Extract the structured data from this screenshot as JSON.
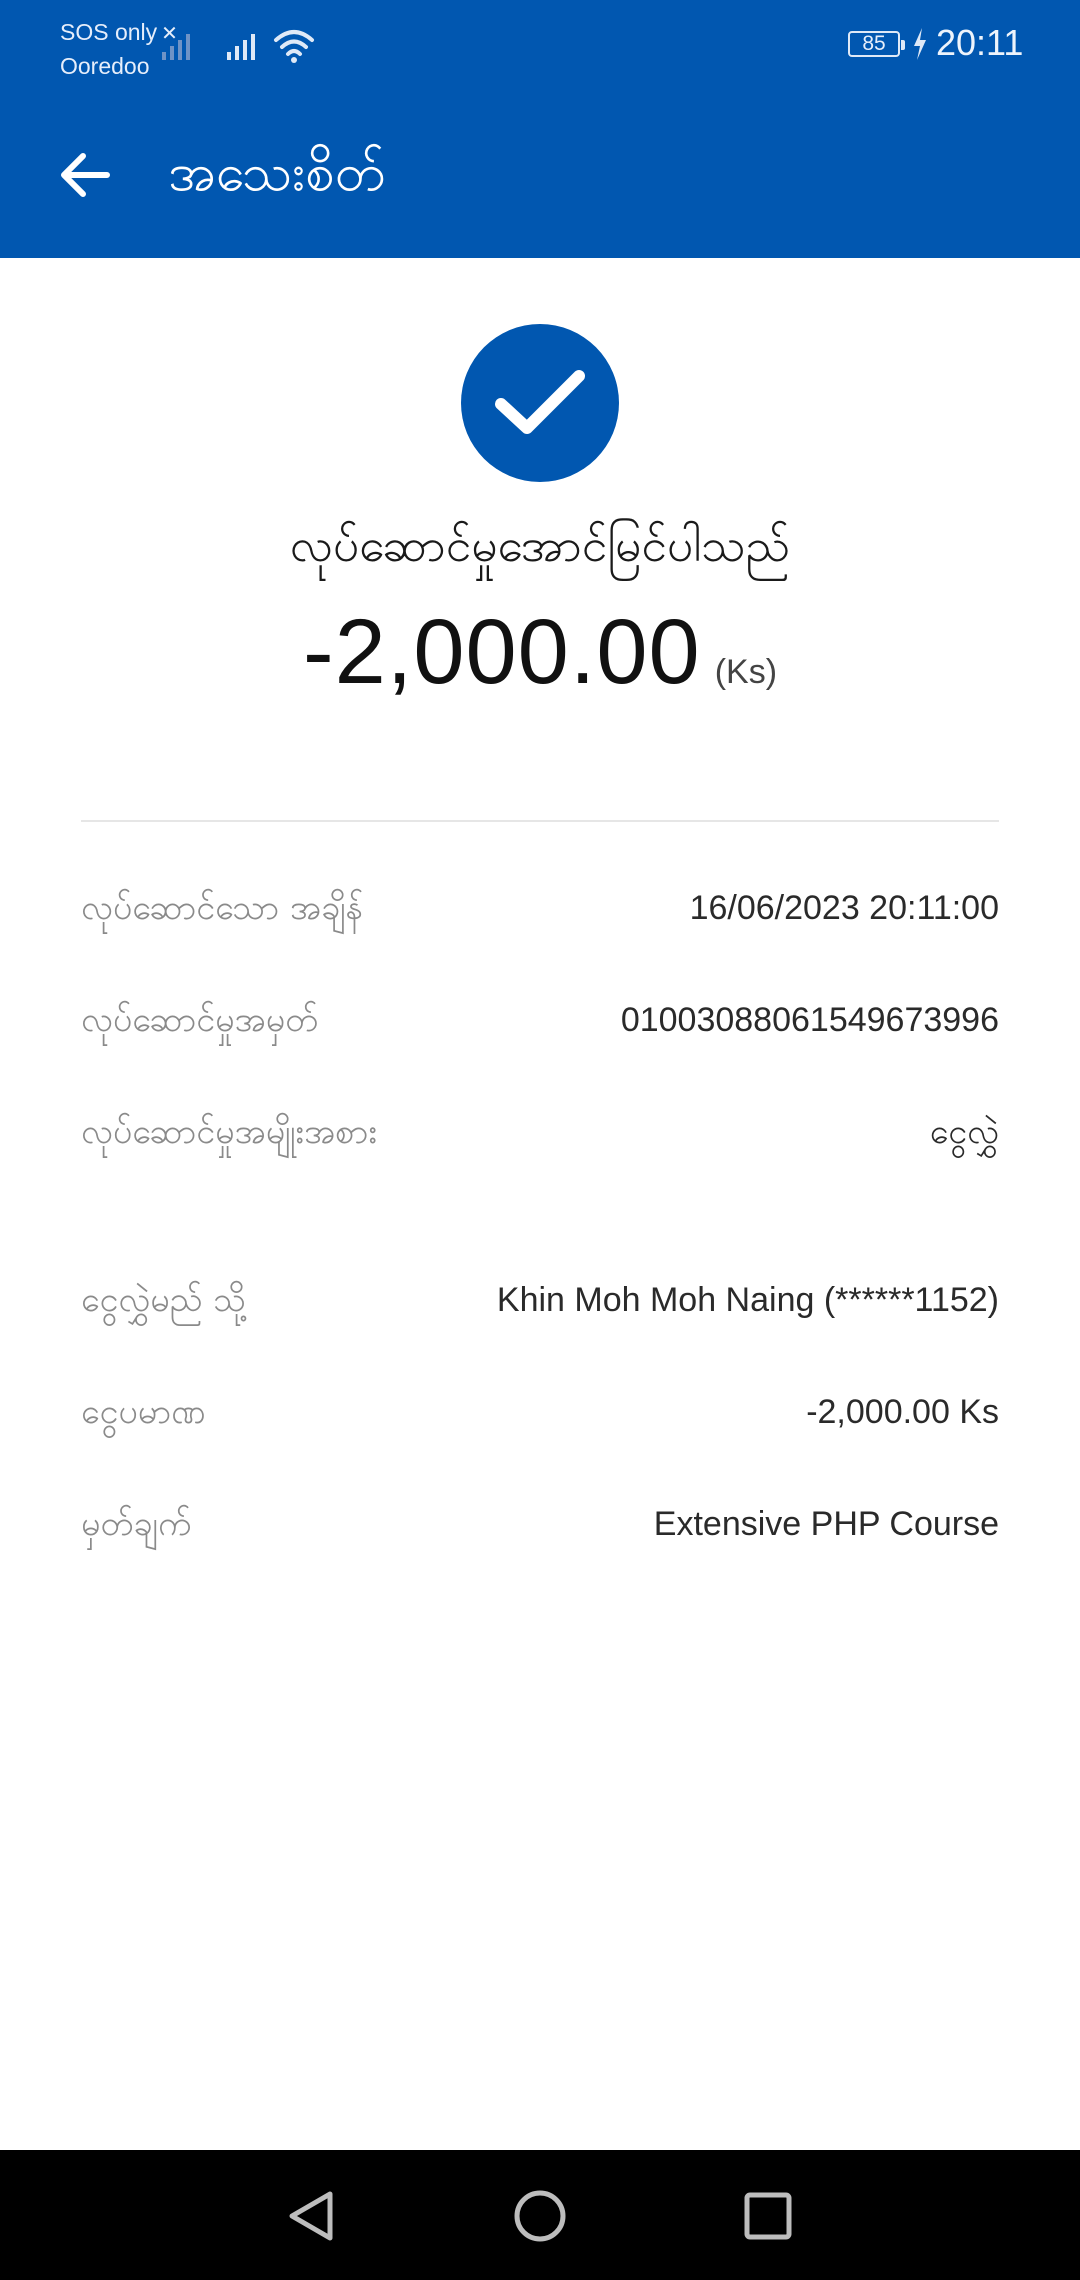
{
  "status_bar": {
    "carrier_line1": "SOS only",
    "carrier_line2": "Ooredoo",
    "battery": "85",
    "time": "20:11"
  },
  "app_bar": {
    "title": "အသေးစိတ်",
    "back_icon": "arrow-left-icon"
  },
  "receipt": {
    "status": "လုပ်ဆောင်မှုအောင်မြင်ပါသည်",
    "amount": "-2,000.00",
    "currency": "(Ks)",
    "success_icon": "checkmark-icon",
    "accent_color": "#0157b0"
  },
  "details": [
    {
      "label": "လုပ်ဆောင်သော အချိန်",
      "value": "16/06/2023 20:11:00"
    },
    {
      "label": "လုပ်ဆောင်မှုအမှတ်",
      "value": "01003088061549673996"
    },
    {
      "label": "လုပ်ဆောင်မှုအမျိုးအစား",
      "value": "ငွေလွှဲ"
    },
    {
      "label": "ငွေလွှဲမည် သို့",
      "value": "Khin Moh Moh Naing (******1152)"
    },
    {
      "label": "ငွေပမာဏ",
      "value": "-2,000.00 Ks"
    },
    {
      "label": "မှတ်ချက်",
      "value": "Extensive PHP Course"
    }
  ],
  "nav_bar": {
    "back_icon": "triangle-back-icon",
    "home_icon": "circle-home-icon",
    "recent_icon": "square-recent-icon"
  }
}
